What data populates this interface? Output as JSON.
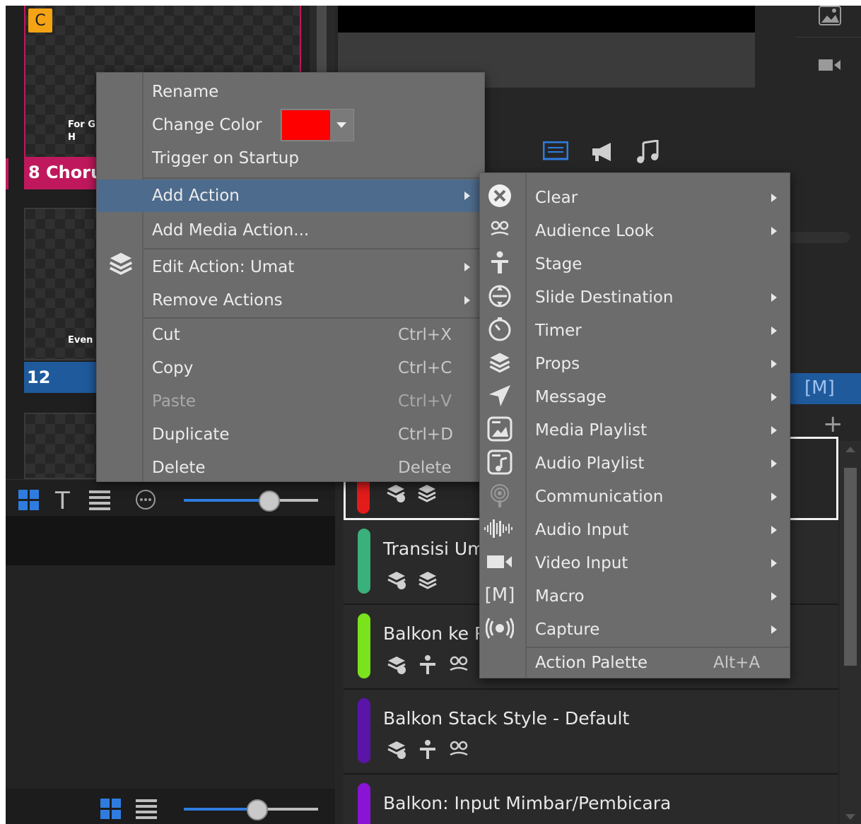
{
  "slides": [
    {
      "label": "8  Choru",
      "overlay": "For G\nH",
      "badge": "C",
      "color": "#c0185c"
    },
    {
      "label": "12",
      "overlay": "Even a",
      "color": "#1f5a9c"
    }
  ],
  "cues": [
    {
      "title": "",
      "color": "#e31b1b"
    },
    {
      "title": "Transisi Uma",
      "color": "#3ab07a"
    },
    {
      "title": "Balkon ke Ro",
      "color": "#7ae31b"
    },
    {
      "title": "Balkon Stack Style - Default",
      "color": "#5a14a8"
    },
    {
      "title": "Balkon: Input Mimbar/Pembicara",
      "color": "#8a14d6"
    }
  ],
  "context_menu": {
    "rename": "Rename",
    "change_color": "Change Color",
    "change_color_swatch": "#ff0000",
    "trigger_on_startup": "Trigger on Startup",
    "add_action": "Add Action",
    "add_media_action": "Add Media Action...",
    "edit_action": "Edit Action: Umat",
    "remove_actions": "Remove Actions",
    "cut": "Cut",
    "cut_sc": "Ctrl+X",
    "copy": "Copy",
    "copy_sc": "Ctrl+C",
    "paste": "Paste",
    "paste_sc": "Ctrl+V",
    "duplicate": "Duplicate",
    "duplicate_sc": "Ctrl+D",
    "delete": "Delete",
    "delete_sc": "Delete"
  },
  "submenu": {
    "items": [
      {
        "label": "Clear",
        "icon": "clear-icon"
      },
      {
        "label": "Audience Look",
        "icon": "audience-look-icon"
      },
      {
        "label": "Stage",
        "icon": "stage-icon"
      },
      {
        "label": "Slide Destination",
        "icon": "slide-destination-icon"
      },
      {
        "label": "Timer",
        "icon": "timer-icon"
      },
      {
        "label": "Props",
        "icon": "props-icon"
      },
      {
        "label": "Message",
        "icon": "message-icon"
      },
      {
        "label": "Media Playlist",
        "icon": "media-playlist-icon"
      },
      {
        "label": "Audio Playlist",
        "icon": "audio-playlist-icon"
      },
      {
        "label": "Communication",
        "icon": "communication-icon"
      },
      {
        "label": "Audio Input",
        "icon": "audio-input-icon"
      },
      {
        "label": "Video Input",
        "icon": "video-input-icon"
      },
      {
        "label": "Macro",
        "icon": "macro-icon"
      },
      {
        "label": "Capture",
        "icon": "capture-icon"
      }
    ],
    "action_palette": "Action Palette",
    "action_palette_sc": "Alt+A"
  },
  "right_panel": {
    "macro_tag": "[M]"
  },
  "colors": {
    "accent_blue": "#2f7ce0",
    "menu_bg": "#6c6c6c",
    "highlight": "#4d6b8c"
  },
  "slider_bottom_left": {
    "value_pct": 63
  },
  "slider_bottom": {
    "value_pct": 54
  }
}
